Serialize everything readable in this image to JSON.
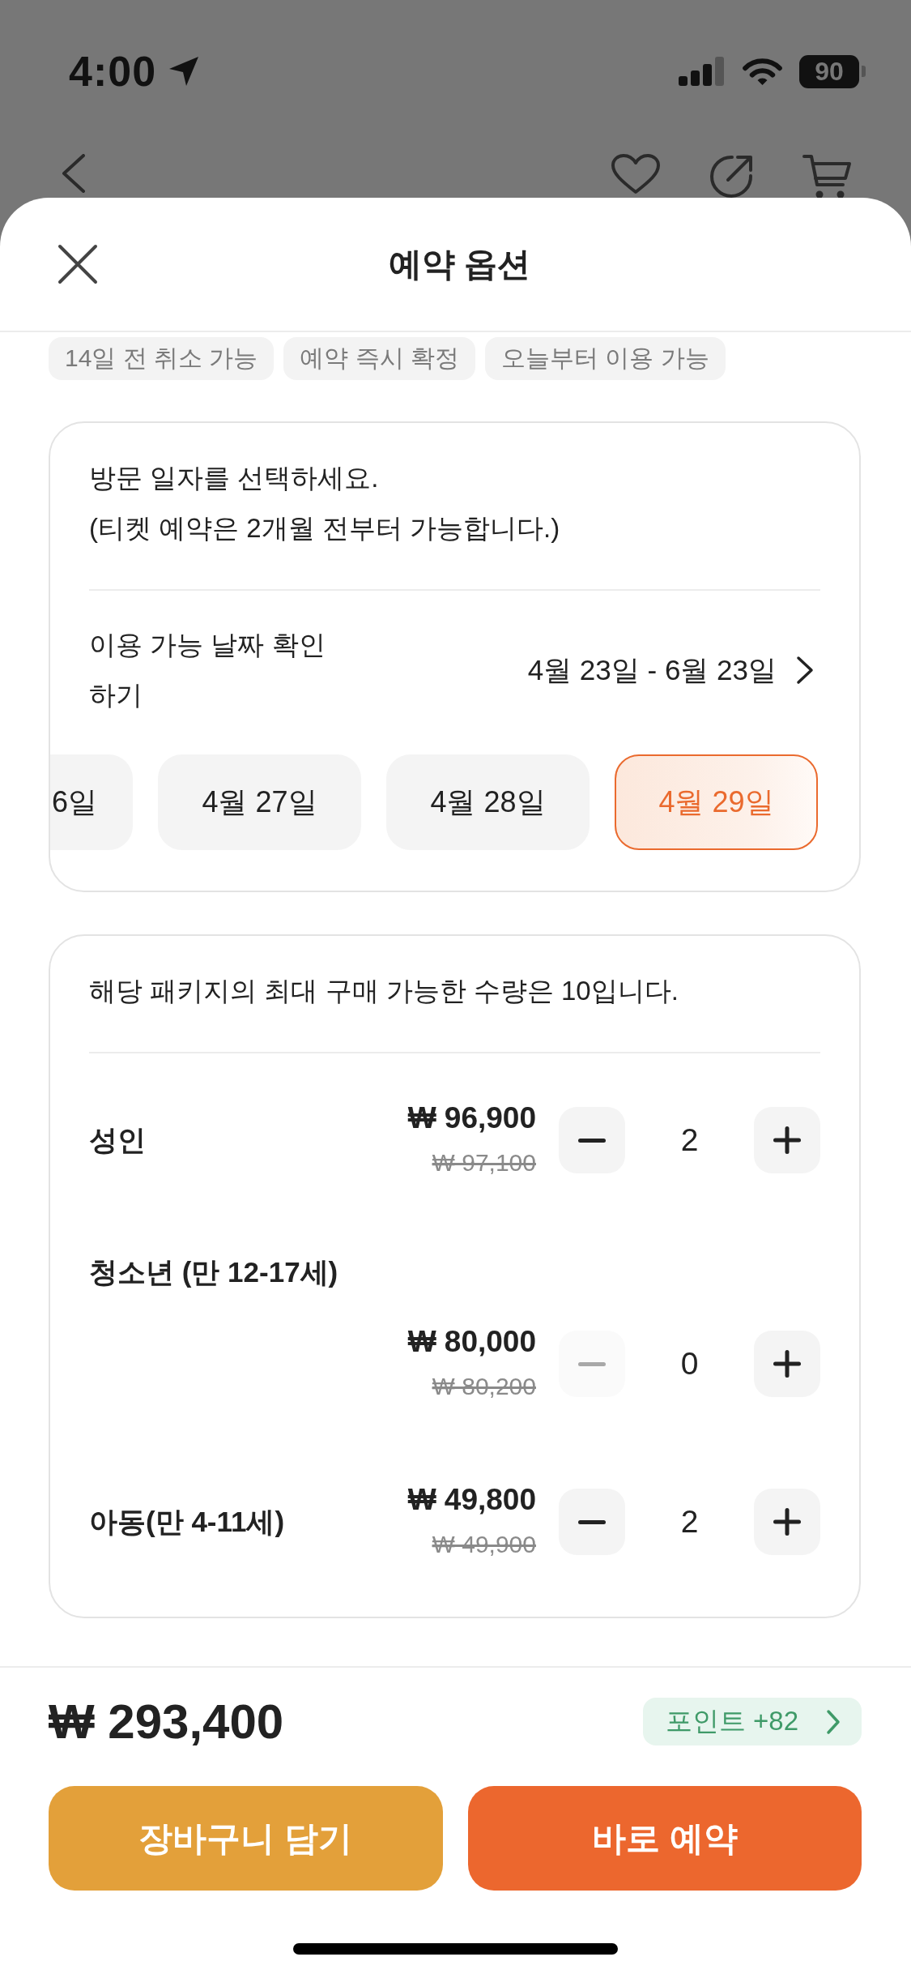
{
  "status_bar": {
    "time": "4:00",
    "battery": "90"
  },
  "sheet_header": {
    "title": "예약 옵션"
  },
  "tags": [
    "14일 전 취소 가능",
    "예약 즉시 확정",
    "오늘부터 이용 가능"
  ],
  "date_card": {
    "instruction": "방문 일자를 선택하세요.",
    "note": "(티켓 예약은 2개월 전부터 가능합니다.)",
    "availability_label": "이용 가능 날짜 확인 하기",
    "availability_range": "4월 23일 - 6월 23일",
    "dates": [
      {
        "label": "6일",
        "selected": false,
        "cut_off": true
      },
      {
        "label": "4월 27일",
        "selected": false,
        "cut_off": false
      },
      {
        "label": "4월 28일",
        "selected": false,
        "cut_off": false
      },
      {
        "label": "4월 29일",
        "selected": true,
        "cut_off": false
      }
    ]
  },
  "quantity_card": {
    "notice": "해당 패키지의 최대 구매 가능한 수량은 10입니다.",
    "rows": [
      {
        "kind": "inline",
        "label": "성인",
        "price": "₩ 96,900",
        "original_price": "₩ 97,100",
        "count": "2",
        "minus_disabled": false
      },
      {
        "kind": "stacked",
        "label": "청소년 (만 12-17세)",
        "price": "₩ 80,000",
        "original_price": "₩ 80,200",
        "count": "0",
        "minus_disabled": true
      },
      {
        "kind": "inline",
        "label": "아동(만 4-11세)",
        "price": "₩ 49,800",
        "original_price": "₩ 49,900",
        "count": "2",
        "minus_disabled": false
      }
    ]
  },
  "footer": {
    "total": "₩ 293,400",
    "points": "포인트 +82",
    "buttons": [
      {
        "kind": "cart",
        "label": "장바구니 담기"
      },
      {
        "kind": "buy",
        "label": "바로 예약"
      }
    ]
  }
}
